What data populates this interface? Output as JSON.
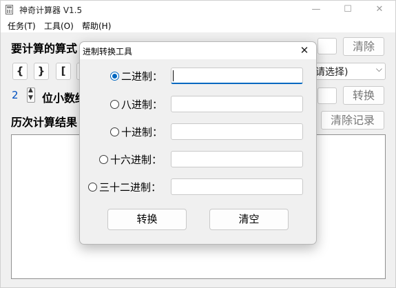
{
  "window": {
    "title": "神奇计算器 V1.5",
    "minimize_glyph": "—",
    "maximize_glyph": "☐",
    "close_glyph": "✕"
  },
  "menu": [
    "任务(T)",
    "工具(O)",
    "帮助(H)"
  ],
  "main": {
    "expression_label": "要计算的算式",
    "clear_button": "清除",
    "bracket_buttons": [
      "{",
      "}",
      "["
    ],
    "operation_select_value": "请选择)",
    "decimals_value": "2",
    "decimals_label": "位小数结",
    "convert_button": "转换",
    "history_label": "历次计算结果",
    "clear_history_button": "清除记录"
  },
  "dialog": {
    "title": "进制转换工具",
    "close_glyph": "✕",
    "rows": [
      {
        "label": "二进制：",
        "value": "",
        "selected": true
      },
      {
        "label": "八进制：",
        "value": "",
        "selected": false
      },
      {
        "label": "十进制：",
        "value": "",
        "selected": false
      },
      {
        "label": "十六进制：",
        "value": "",
        "selected": false
      },
      {
        "label": "三十二进制：",
        "value": "",
        "selected": false
      }
    ],
    "convert_button": "转换",
    "clear_button": "清空"
  },
  "colors": {
    "accent": "#0067c0",
    "window_bg": "#f0f0f0"
  }
}
